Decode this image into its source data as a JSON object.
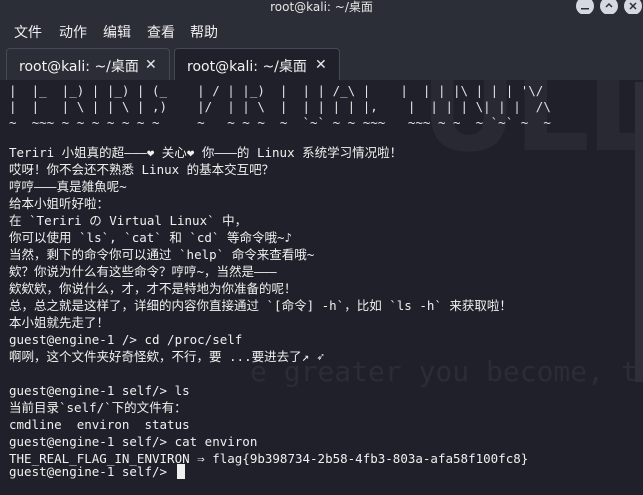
{
  "window": {
    "title": "root@kali: ~/桌面"
  },
  "menu": {
    "items": [
      "文件",
      "动作",
      "编辑",
      "查看",
      "帮助"
    ]
  },
  "tabs": [
    {
      "label": "root@kali: ~/桌面",
      "close": "✕",
      "active": false
    },
    {
      "label": "root@kali: ~/桌面",
      "close": "✕",
      "active": true
    }
  ],
  "terminal": {
    "watermark": "ULL LOO",
    "watermark_line": "e greater you become, the more you",
    "ascii_art": [
      "|  |_  |_) | |_) | (_    | / | |_)  |  | | /_\\ |    |  | | |\\ | | | '\\/",
      "|  |   | \\ | | \\ | ,)    |/  | | \\  |  | | | | |,    |  | | | \\| | |  /\\",
      "~  ~~~ ~ ~ ~ ~ ~ ~ ~     ~   ~ ~ ~  ~  `~` ~ ~ ~~~   ~~~ ~ ~  ~ `~` ~  ~"
    ],
    "lines": [
      "Teriri 小姐真的超———❤ 关心❤ 你———的 Linux 系统学习情况啦！",
      "哎呀！你不会还不熟悉 Linux 的基本交互吧？",
      "哼哼———真是雑魚呢~",
      "给本小姐听好啦：",
      "在 `Teriri の Virtual Linux` 中，",
      "你可以使用 `ls`, `cat` 和 `cd` 等命令哦~♪",
      "当然，剩下的命令你可以通过 `help` 命令来查看哦~",
      "欸？你说为什么有这些命令？哼哼~，当然是———",
      "欸欸欸，你说什么，才，才不是特地为你准备的呢！",
      "总，总之就是这样了，详细的内容你直接通过 `[命令] -h`，比如 `ls -h` 来获取啦！",
      "本小姐就先走了！",
      "guest@engine-1 /> cd /proc/self",
      "啊咧，这个文件夹好奇怪欸，不行，要 ...要进去了↗ ➶",
      "",
      "guest@engine-1 self/> ls",
      "当前目录`self/`下的文件有：",
      "cmdline  environ  status",
      "guest@engine-1 self/> cat environ",
      "THE_REAL_FLAG_IN_ENVIRON ⇒ flag{9b398734-2b58-4fb3-803a-afa58f100fc8}",
      "",
      "guest@engine-1 self/> "
    ]
  }
}
